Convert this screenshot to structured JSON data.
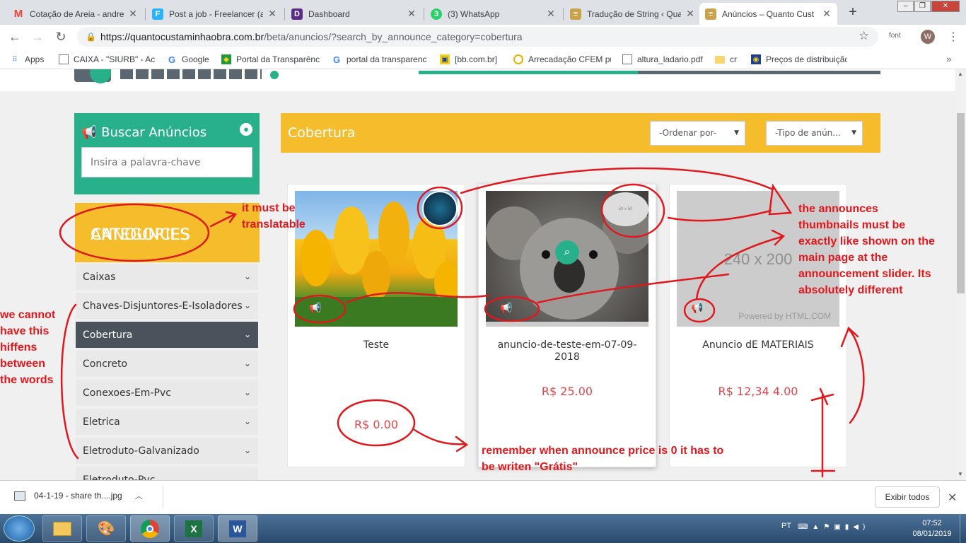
{
  "browser": {
    "tabs": [
      {
        "title": "Cotação de Areia - andre",
        "icon": "gmail-icon",
        "glyph": "M",
        "color": "#ea4335"
      },
      {
        "title": "Post a job - Freelancer (a",
        "icon": "freelancer-icon",
        "glyph": "F",
        "color": "#29b2fe"
      },
      {
        "title": "Dashboard",
        "icon": "dashboard-icon",
        "glyph": "D",
        "color": "#5b2c87"
      },
      {
        "title": "(3) WhatsApp",
        "icon": "whatsapp-icon",
        "glyph": "3",
        "color": "#25d366"
      },
      {
        "title": "Tradução de String ‹ Qua",
        "icon": "site-icon",
        "glyph": "≡",
        "color": "#c9a24a"
      },
      {
        "title": "Anúncios – Quanto Cust",
        "icon": "site-icon",
        "glyph": "≡",
        "color": "#c9a24a"
      }
    ],
    "url_host": "https://quantocustaminhaobra.com.br",
    "url_path": "/beta/anuncios/?search_by_announce_category=cobertura",
    "ext_label": "font",
    "profile_initial": "W",
    "bookmarks": [
      {
        "label": "Apps",
        "icon": "apps-grid-icon"
      },
      {
        "label": "CAIXA - \"SIURB\" - Ac",
        "icon": "page-icon"
      },
      {
        "label": "Google",
        "icon": "google-icon"
      },
      {
        "label": "Portal da Transparênc",
        "icon": "brazil-flag-icon"
      },
      {
        "label": "portal da transparenc",
        "icon": "google-icon"
      },
      {
        "label": "[bb.com.br]",
        "icon": "bb-icon"
      },
      {
        "label": "Arrecadação CFEM pu",
        "icon": "circle-icon"
      },
      {
        "label": "altura_ladario.pdf",
        "icon": "page-icon"
      },
      {
        "label": "cr",
        "icon": "folder-icon"
      },
      {
        "label": "Preços de distribuição",
        "icon": "gov-icon"
      }
    ]
  },
  "sidebar": {
    "search_title": "Buscar Anúncios",
    "search_placeholder": "Insira a palavra-chave",
    "categories_title_line1": "ANNOUNCES",
    "categories_title_line2": "CATEGORIES",
    "categories": [
      "Caixas",
      "Chaves-Disjuntores-E-Isoladores",
      "Cobertura",
      "Concreto",
      "Conexoes-Em-Pvc",
      "Eletrica",
      "Eletroduto-Galvanizado",
      "Eletroduto-Pvc"
    ],
    "selected_category": "Cobertura"
  },
  "main": {
    "title": "Cobertura",
    "order_select": "-Ordenar por-",
    "type_select": "-Tipo de anún...",
    "cards": [
      {
        "title": "Teste",
        "price": "R$ 0.00"
      },
      {
        "title": "anuncio-de-teste-em-07-09-2018",
        "price": "R$ 25.00",
        "avatar_text": "50 x 50"
      },
      {
        "title": "Anuncio dE MATERIAIS",
        "price": "R$ 12,34 4.00",
        "placeholder_text": "240 x 200",
        "placeholder_credit": "Powered by HTML.COM"
      }
    ]
  },
  "annotations": {
    "translatable": "it must be translatable",
    "hyphens": "we cannot have this hiffens between the words",
    "thumbnails": "the announces thumbnails must be exactly like shown on the main page at the announcement slider. Its absolutely different",
    "free_price": "remember when announce price is 0 it has to be writen \"Grátis\"",
    "annotation_color": "#e0181d"
  },
  "downloads": {
    "file": "04-1-19 - share th....jpg",
    "show_all": "Exibir todos"
  },
  "taskbar": {
    "lang": "PT",
    "time": "07:52",
    "date": "08/01/2019"
  },
  "colors": {
    "green": "#28b08a",
    "yellow": "#f5bc2c",
    "selected": "#4a535c",
    "price": "#e2454b"
  }
}
